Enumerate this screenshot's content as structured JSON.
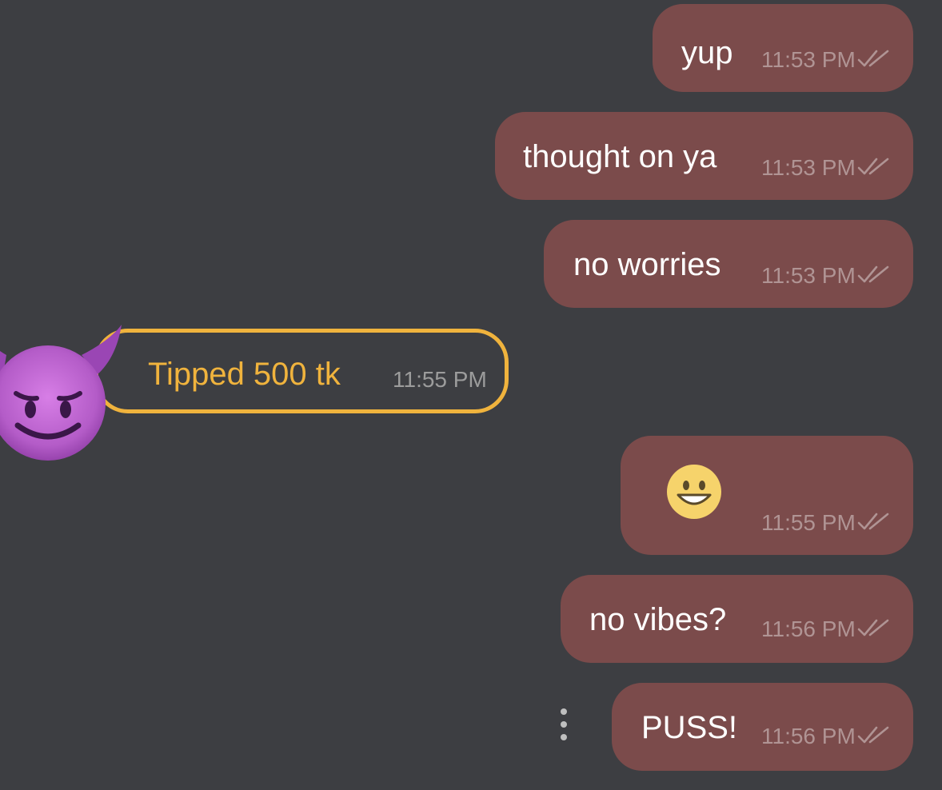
{
  "messages": [
    {
      "text": "yup",
      "time": "11:53 PM",
      "status_icon": "double-check-icon"
    },
    {
      "text": "thought on ya",
      "time": "11:53 PM",
      "status_icon": "double-check-icon"
    },
    {
      "text": "no worries",
      "time": "11:53 PM",
      "status_icon": "double-check-icon"
    },
    {
      "text": "Tipped 500 tk",
      "time": "11:55 PM",
      "sender_avatar": "smiling-devil-emoji"
    },
    {
      "emoji": "grinning-face-emoji",
      "time": "11:55 PM",
      "status_icon": "double-check-icon"
    },
    {
      "text": "no vibes?",
      "time": "11:56 PM",
      "status_icon": "double-check-icon"
    },
    {
      "text": "PUSS!",
      "time": "11:56 PM",
      "status_icon": "double-check-icon"
    }
  ],
  "icons": {
    "more_options": "vertical-dots-icon"
  },
  "colors": {
    "background": "#3d3e42",
    "outgoing_bubble": "#7b4b4b",
    "tip_accent": "#f0b33d",
    "message_text": "#ffffff",
    "outgoing_time": "#b09494"
  }
}
